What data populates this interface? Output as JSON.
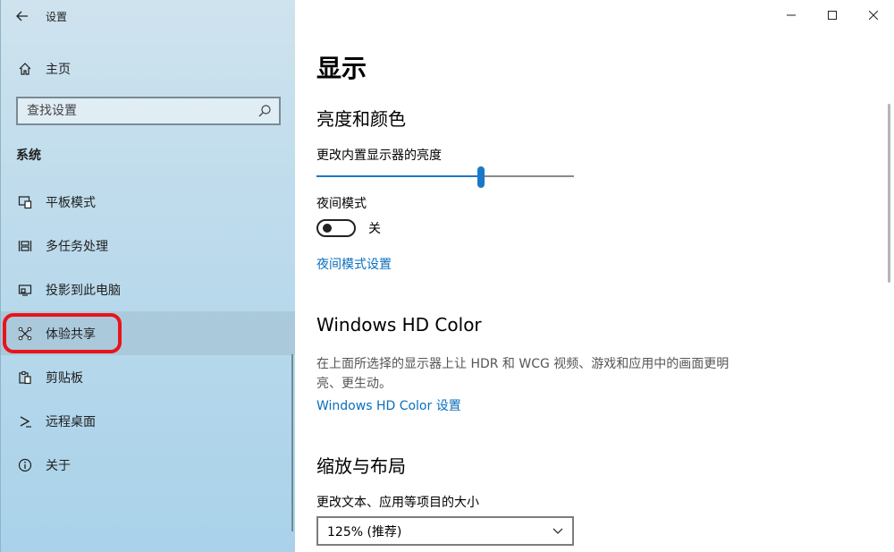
{
  "window": {
    "title": "设置"
  },
  "sidebar": {
    "home_label": "主页",
    "search_placeholder": "查找设置",
    "group_title": "系统",
    "items": [
      {
        "label": "平板模式",
        "icon": "tablet-mode-icon"
      },
      {
        "label": "多任务处理",
        "icon": "multitasking-icon"
      },
      {
        "label": "投影到此电脑",
        "icon": "project-to-pc-icon"
      },
      {
        "label": "体验共享",
        "icon": "shared-experiences-icon",
        "selected": true
      },
      {
        "label": "剪贴板",
        "icon": "clipboard-icon"
      },
      {
        "label": "远程桌面",
        "icon": "remote-desktop-icon"
      },
      {
        "label": "关于",
        "icon": "info-icon"
      }
    ]
  },
  "main": {
    "page_title": "显示",
    "brightness": {
      "section_title": "亮度和颜色",
      "slider_label": "更改内置显示器的亮度",
      "slider_value": 0.64
    },
    "night_light": {
      "label": "夜间模式",
      "state_label": "关",
      "settings_link": "夜间模式设置"
    },
    "hd_color": {
      "section_title": "Windows HD Color",
      "description": "在上面所选择的显示器上让 HDR 和 WCG 视频、游戏和应用中的画面更明亮、更生动。",
      "link": "Windows HD Color 设置"
    },
    "scale_layout": {
      "section_title": "缩放与布局",
      "scale_label": "更改文本、应用等项目的大小",
      "scale_value": "125% (推荐)"
    }
  },
  "colors": {
    "accent": "#1b78c8",
    "link": "#0a6ebd",
    "highlight_ring": "#e8141b"
  }
}
